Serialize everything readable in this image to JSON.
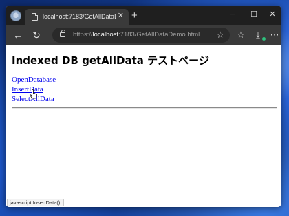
{
  "browser": {
    "tab_title": "localhost:7183/GetAllDataDemo.h",
    "tab_close_glyph": "✕",
    "new_tab_glyph": "+",
    "url_prefix": "https://",
    "url_host": "localhost",
    "url_rest": ":7183/GetAllDataDemo.html",
    "window_controls": {
      "minimize": "─",
      "maximize": "☐",
      "close": "✕"
    },
    "nav": {
      "back": "←",
      "reload": "↻"
    },
    "icons": [
      "profile-icon",
      "page-icon",
      "lock-icon",
      "star-icon",
      "favorites-icon",
      "downloads-icon",
      "more-icon"
    ]
  },
  "page": {
    "heading": "Indexed DB getAllData テストページ",
    "links": [
      "OpenDatabase",
      "InsertData",
      "SelectAllData"
    ]
  },
  "status_bar": {
    "text": "javascript:InsertData();"
  },
  "colors": {
    "link": "#0000ee",
    "titlebar": "#1f1f1f",
    "toolbar": "#3a3a3a"
  }
}
